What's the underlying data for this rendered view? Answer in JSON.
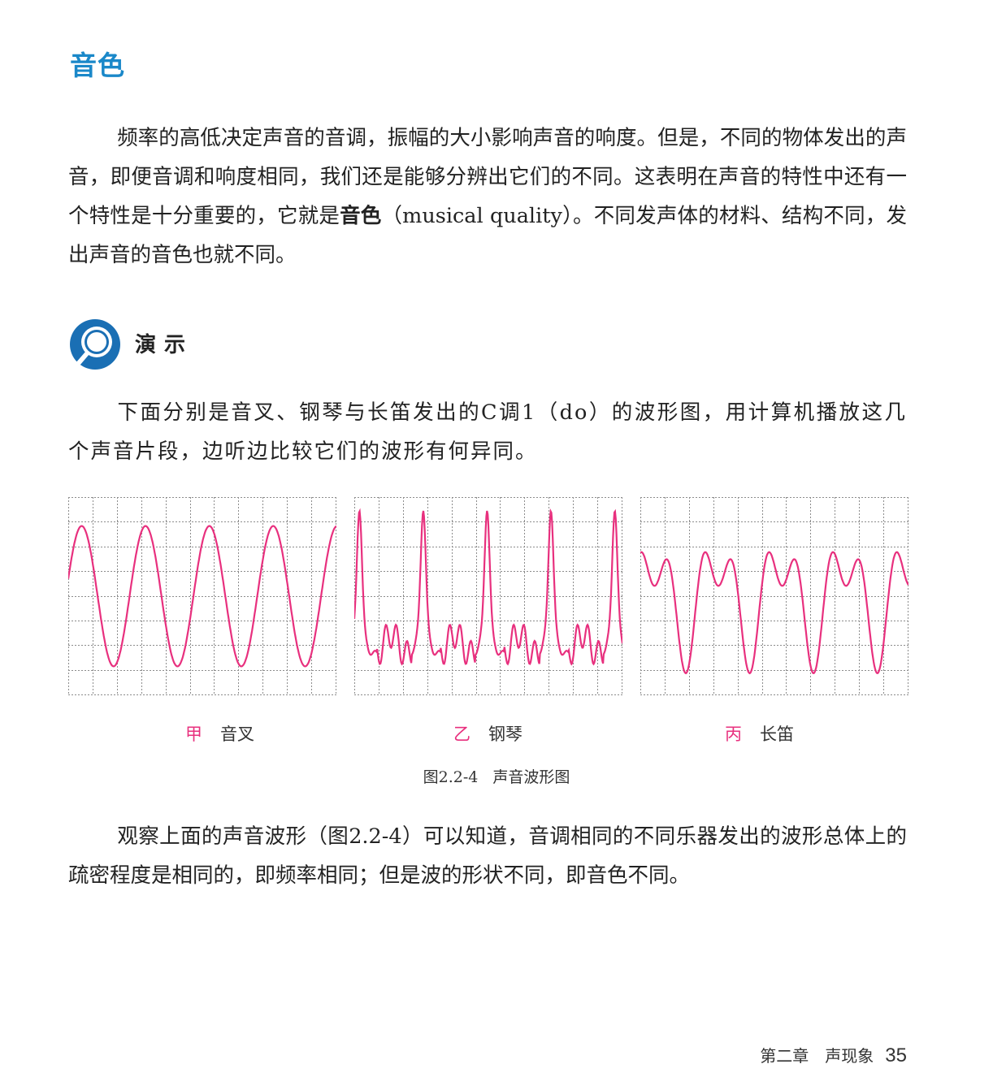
{
  "section_title": "音色",
  "intro_paragraph": {
    "before_term": "频率的高低决定声音的音调，振幅的大小影响声音的响度。但是，不同的物体发出的声音，即便音调和响度相同，我们还是能够分辨出它们的不同。这表明在声音的特性中还有一个特性是十分重要的，它就是",
    "term": "音色",
    "after_term": "（musical quality）。不同发声体的材料、结构不同，发出声音的音色也就不同。"
  },
  "demo": {
    "icon": "magnifier-icon",
    "title": "演示",
    "text": "下面分别是音叉、钢琴与长笛发出的C调1（do）的波形图，用计算机播放这几个声音片段，边听边比较它们的波形有何异同。"
  },
  "figure": {
    "wave_color": "#e8307e",
    "panels": [
      {
        "mark": "甲",
        "label": "音叉",
        "wave": "tuning-fork"
      },
      {
        "mark": "乙",
        "label": "钢琴",
        "wave": "piano"
      },
      {
        "mark": "丙",
        "label": "长笛",
        "wave": "flute"
      }
    ],
    "caption_number": "图2.2-4",
    "caption_title": "声音波形图"
  },
  "summary_paragraph": "观察上面的声音波形（图2.2-4）可以知道，音调相同的不同乐器发出的波形总体上的疏密程度是相同的，即频率相同；但是波的形状不同，即音色不同。",
  "footer": {
    "chapter": "第二章　声现象",
    "page_number": "35"
  }
}
